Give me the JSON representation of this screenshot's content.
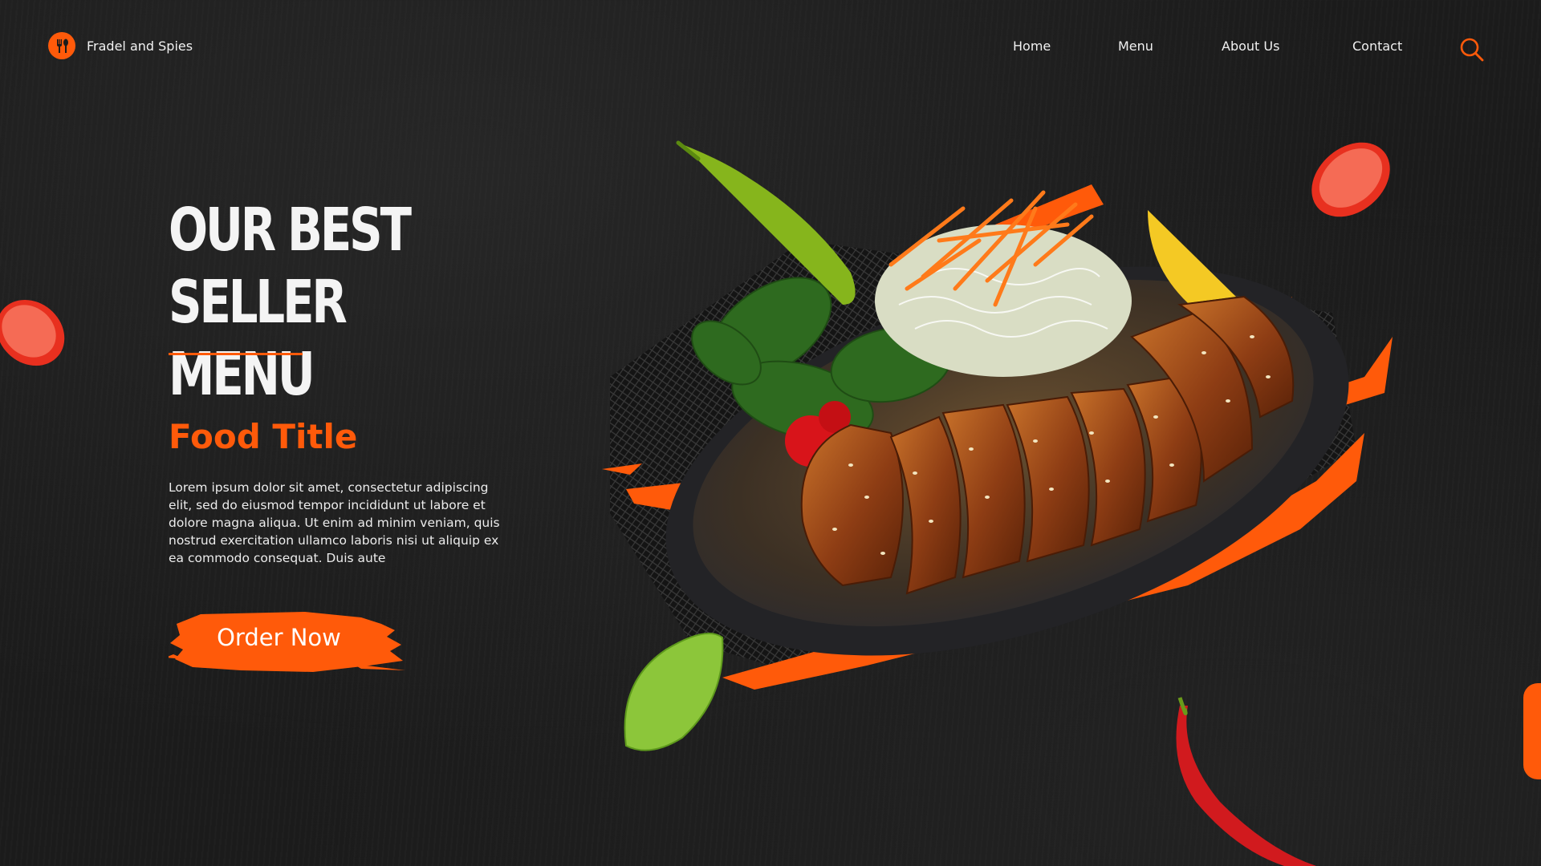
{
  "brand": {
    "name": "Fradel and Spies",
    "logo_icon": "fork-spoon-icon"
  },
  "nav": {
    "links": [
      "Home",
      "Menu",
      "About Us",
      "Contact"
    ],
    "search_icon": "search-icon"
  },
  "hero": {
    "title_line1": "OUR BEST",
    "title_line2": "SELLER MENU",
    "food_title": "Food Title",
    "description": "Lorem ipsum dolor sit amet, consectetur adipiscing elit, sed do eiusmod tempor incididunt ut labore et dolore magna aliqua. Ut enim ad minim veniam, quis nostrud exercitation ullamco laboris nisi ut aliquip ex ea commodo consequat. Duis aute",
    "cta_label": "Order Now"
  },
  "colors": {
    "accent": "#ff5a0a",
    "background": "#1b1b1b",
    "text": "#f2f2f2"
  }
}
